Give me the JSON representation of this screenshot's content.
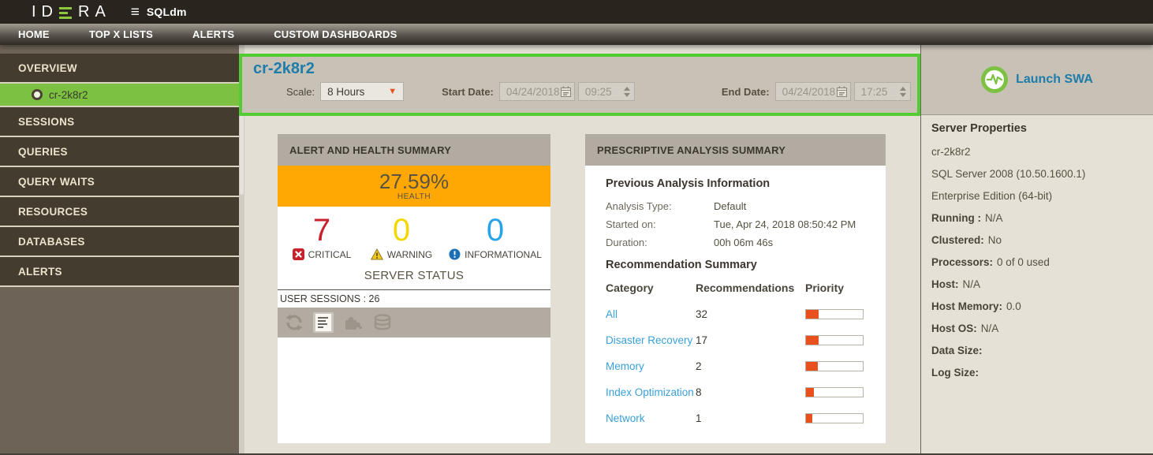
{
  "topbar": {
    "logo_prefix": "ID",
    "logo_suffix": "RA",
    "menu_icon": "≡",
    "app_name": "SQLdm"
  },
  "nav": {
    "items": [
      {
        "label": "HOME"
      },
      {
        "label": "TOP X LISTS"
      },
      {
        "label": "ALERTS"
      },
      {
        "label": "CUSTOM DASHBOARDS"
      }
    ]
  },
  "sidebar": {
    "items": [
      {
        "label": "OVERVIEW"
      },
      {
        "label": "cr-2k8r2"
      },
      {
        "label": "SESSIONS"
      },
      {
        "label": "QUERIES"
      },
      {
        "label": "QUERY WAITS"
      },
      {
        "label": "RESOURCES"
      },
      {
        "label": "DATABASES"
      },
      {
        "label": "ALERTS"
      }
    ]
  },
  "header": {
    "title": "cr-2k8r2",
    "scale_label": "Scale:",
    "scale_value": "8 Hours",
    "start_date_label": "Start Date:",
    "start_date": "04/24/2018",
    "start_time": "09:25",
    "end_date_label": "End Date:",
    "end_date": "04/24/2018",
    "end_time": "17:25"
  },
  "alert_summary": {
    "title": "ALERT AND HEALTH SUMMARY",
    "health_pct": "27.59%",
    "health_label": "HEALTH",
    "critical_count": "7",
    "critical_label": "CRITICAL",
    "warning_count": "0",
    "warning_label": "WARNING",
    "info_count": "0",
    "info_label": "INFORMATIONAL",
    "server_status_label": "SERVER STATUS",
    "user_sessions": "USER SESSIONS : 26"
  },
  "prescriptive": {
    "title": "PRESCRIPTIVE ANALYSIS SUMMARY",
    "previous_heading": "Previous Analysis Information",
    "info_rows": [
      {
        "label": "Analysis Type:",
        "value": "Default"
      },
      {
        "label": "Started on:",
        "value": "Tue, Apr 24, 2018 08:50:42 PM"
      },
      {
        "label": "Duration:",
        "value": "00h 06m 46s"
      }
    ],
    "recommendation_heading": "Recommendation Summary",
    "columns": {
      "category": "Category",
      "recommendations": "Recommendations",
      "priority": "Priority"
    },
    "rows": [
      {
        "category": "All",
        "count": "32",
        "priority_pct": "22%"
      },
      {
        "category": "Disaster Recovery",
        "count": "17",
        "priority_pct": "22%"
      },
      {
        "category": "Memory",
        "count": "2",
        "priority_pct": "21%"
      },
      {
        "category": "Index Optimization",
        "count": "8",
        "priority_pct": "14%"
      },
      {
        "category": "Network",
        "count": "1",
        "priority_pct": "11%"
      }
    ]
  },
  "right_panel": {
    "launch_swa": "Launch SWA",
    "server_properties_heading": "Server Properties",
    "properties": [
      {
        "label": "",
        "value": "cr-2k8r2"
      },
      {
        "label": "",
        "value": "SQL Server 2008 (10.50.1600.1)"
      },
      {
        "label": "",
        "value": "Enterprise Edition (64-bit)"
      },
      {
        "label": "Running :",
        "value": "N/A"
      },
      {
        "label": "Clustered:",
        "value": "No"
      },
      {
        "label": "Processors:",
        "value": "0 of 0 used"
      },
      {
        "label": "Host:",
        "value": "N/A"
      },
      {
        "label": "Host Memory:",
        "value": "0.0"
      },
      {
        "label": "Host OS:",
        "value": "N/A"
      },
      {
        "label": "Data Size:",
        "value": ""
      },
      {
        "label": "Log Size:",
        "value": ""
      }
    ]
  },
  "colors": {
    "accent_green": "#7cc142",
    "highlight_border": "#53cb33",
    "health_orange": "#ffa703",
    "critical_red": "#c6222b",
    "warning_yellow": "#f2d800",
    "info_blue": "#2aa3e8",
    "link_blue": "#3aa0d8",
    "title_blue": "#1e7cab",
    "priority_fill": "#e8501e"
  }
}
